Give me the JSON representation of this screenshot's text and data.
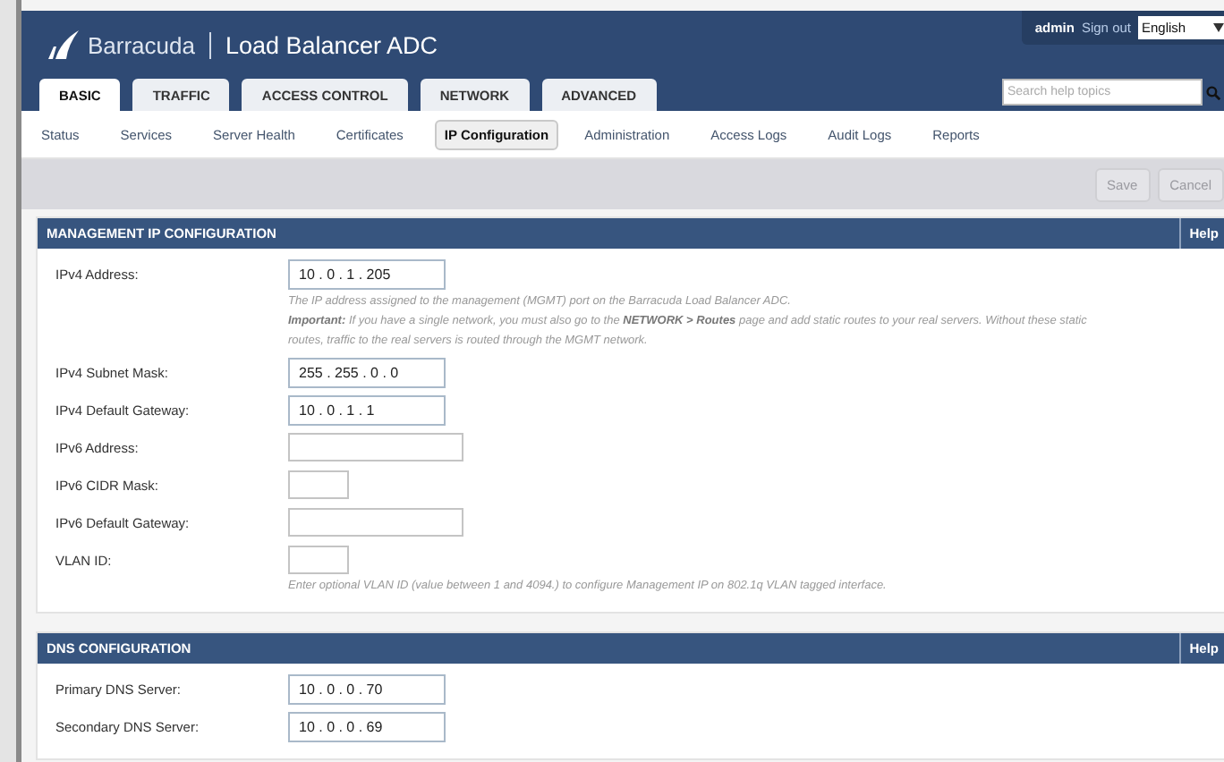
{
  "header": {
    "brand": "Barracuda",
    "product": "Load Balancer ADC",
    "user": "admin",
    "sign_out": "Sign out",
    "language": "English",
    "search": {
      "placeholder": "Search help topics"
    }
  },
  "tabs": [
    {
      "label": "BASIC",
      "selected": true
    },
    {
      "label": "TRAFFIC",
      "selected": false
    },
    {
      "label": "ACCESS CONTROL",
      "selected": false
    },
    {
      "label": "NETWORK",
      "selected": false
    },
    {
      "label": "ADVANCED",
      "selected": false
    }
  ],
  "subtabs": [
    {
      "label": "Status",
      "selected": false
    },
    {
      "label": "Services",
      "selected": false
    },
    {
      "label": "Server Health",
      "selected": false
    },
    {
      "label": "Certificates",
      "selected": false
    },
    {
      "label": "IP Configuration",
      "selected": true
    },
    {
      "label": "Administration",
      "selected": false
    },
    {
      "label": "Access Logs",
      "selected": false
    },
    {
      "label": "Audit Logs",
      "selected": false
    },
    {
      "label": "Reports",
      "selected": false
    }
  ],
  "toolbar": {
    "buttons": [
      {
        "label": "Save",
        "disabled": true
      },
      {
        "label": "Cancel",
        "disabled": true
      }
    ]
  },
  "sections": [
    {
      "title": "MANAGEMENT IP CONFIGURATION",
      "help": "Help",
      "fields": [
        {
          "label": "IPv4 Address:",
          "kind": "ip",
          "value": "10 . 0 . 1 . 205",
          "notes": [
            "The IP address assigned to the management (MGMT) port on the Barracuda Load Balancer ADC.",
            "**Important:** If you have a single network, you must also go to the **NETWORK > Routes** page and add static routes to your real servers. Without these static routes, traffic to the real servers is routed through the MGMT network."
          ]
        },
        {
          "label": "IPv4 Subnet Mask:",
          "kind": "ip",
          "value": "255 . 255 . 0 . 0"
        },
        {
          "label": "IPv4 Default Gateway:",
          "kind": "ip",
          "value": "10 . 0 . 1 . 1"
        },
        {
          "label": "IPv6 Address:",
          "kind": "text"
        },
        {
          "label": "IPv6 CIDR Mask:",
          "kind": "short"
        },
        {
          "label": "IPv6 Default Gateway:",
          "kind": "text"
        },
        {
          "label": "VLAN ID:",
          "kind": "short",
          "notes": [
            "Enter optional VLAN ID (value between 1 and 4094.) to configure Management IP on 802.1q VLAN tagged interface."
          ]
        }
      ]
    },
    {
      "title": "DNS CONFIGURATION",
      "help": "Help",
      "fields": [
        {
          "label": "Primary DNS Server:",
          "kind": "ip",
          "value": "10 . 0 . 0 . 70"
        },
        {
          "label": "Secondary DNS Server:",
          "kind": "ip",
          "value": "10 . 0 . 0 . 69"
        }
      ]
    }
  ]
}
